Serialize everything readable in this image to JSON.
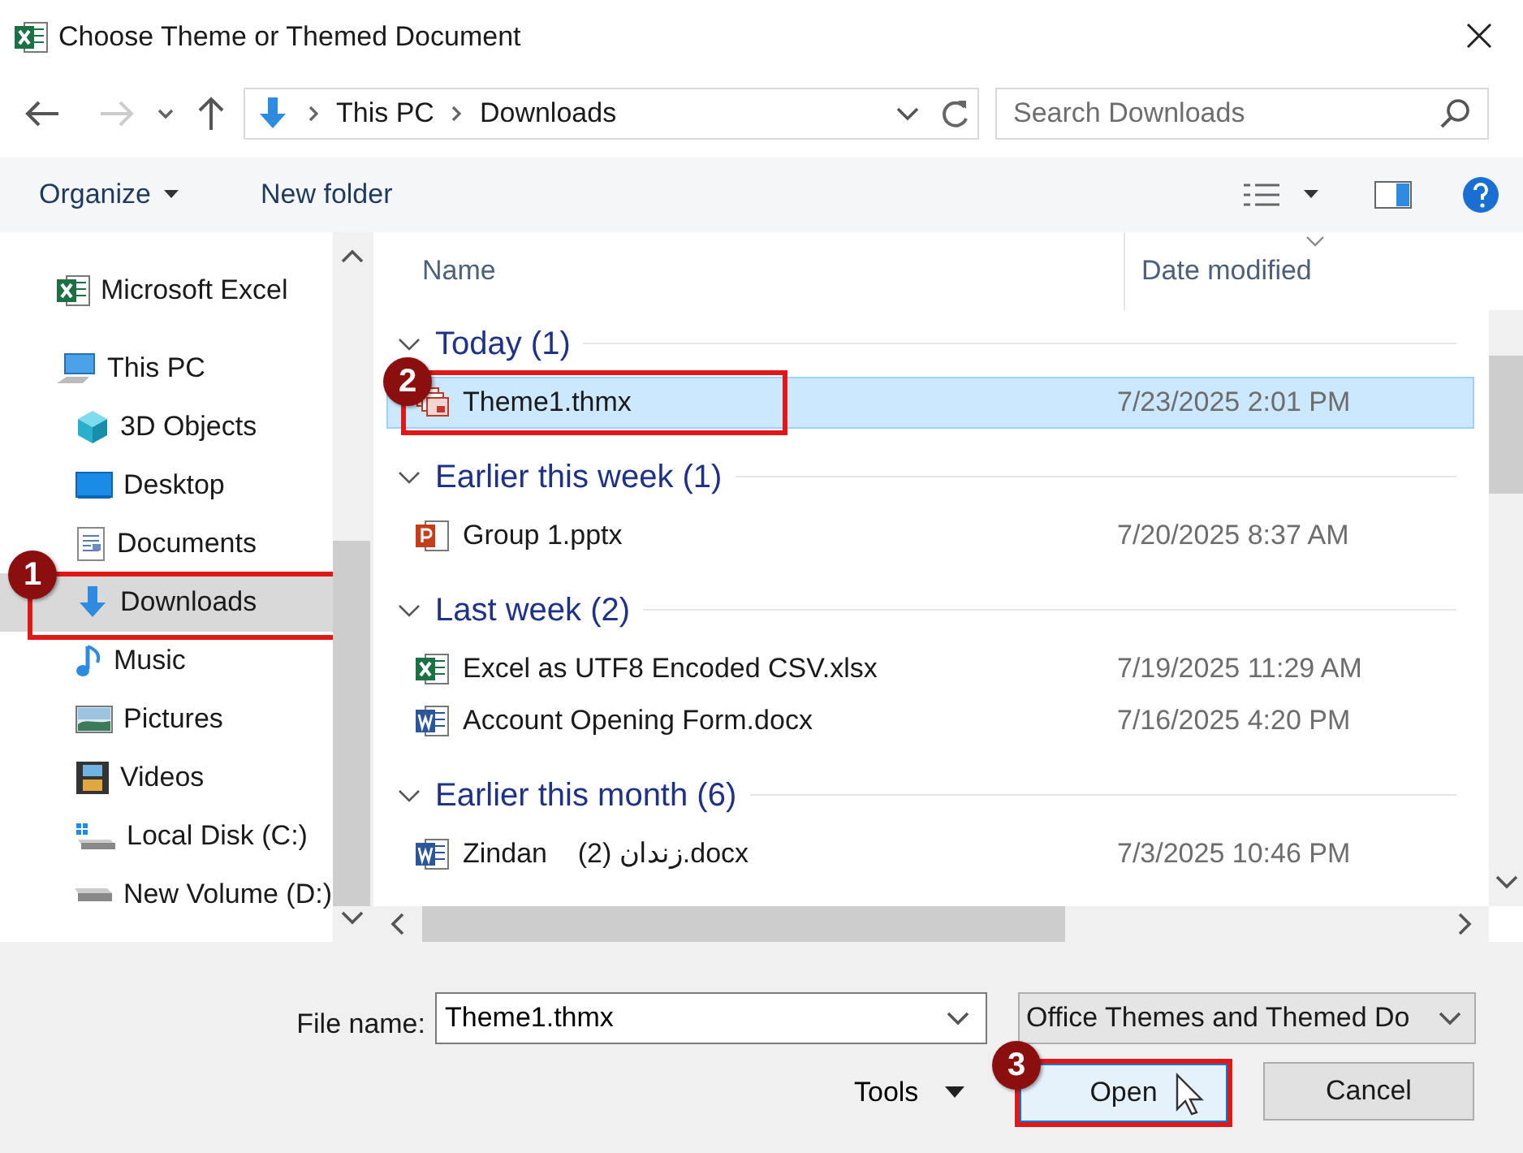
{
  "window": {
    "title": "Choose Theme or Themed Document"
  },
  "address": {
    "path": [
      "This PC",
      "Downloads"
    ]
  },
  "search": {
    "placeholder": "Search Downloads"
  },
  "toolbar": {
    "organize": "Organize",
    "new_folder": "New folder"
  },
  "sidebar": {
    "items": [
      {
        "label": "Microsoft Excel",
        "kind": "excel",
        "selected": false
      },
      {
        "label": "This PC",
        "kind": "pc",
        "selected": false,
        "children": [
          {
            "label": "3D Objects",
            "kind": "cube",
            "selected": false
          },
          {
            "label": "Desktop",
            "kind": "desktop",
            "selected": false
          },
          {
            "label": "Documents",
            "kind": "documents",
            "selected": false
          },
          {
            "label": "Downloads",
            "kind": "downloads",
            "selected": true,
            "callout": "1"
          },
          {
            "label": "Music",
            "kind": "music",
            "selected": false
          },
          {
            "label": "Pictures",
            "kind": "pictures",
            "selected": false
          },
          {
            "label": "Videos",
            "kind": "videos",
            "selected": false
          },
          {
            "label": "Local Disk (C:)",
            "kind": "disk_c",
            "selected": false
          },
          {
            "label": "New Volume (D:)",
            "kind": "disk",
            "selected": false
          }
        ]
      }
    ]
  },
  "file_list": {
    "columns": [
      "Name",
      "Date modified"
    ],
    "groups": [
      {
        "label": "Today (1)",
        "expanded": true,
        "files": [
          {
            "name": "Theme1.thmx",
            "kind": "theme",
            "date": "7/23/2025 2:01 PM",
            "selected": true,
            "callout": "2"
          }
        ]
      },
      {
        "label": "Earlier this week (1)",
        "expanded": true,
        "files": [
          {
            "name": "Group 1.pptx",
            "kind": "pptx",
            "date": "7/20/2025 8:37 AM",
            "selected": false
          }
        ]
      },
      {
        "label": "Last week (2)",
        "expanded": true,
        "files": [
          {
            "name": "Excel as UTF8 Encoded CSV.xlsx",
            "kind": "xlsx",
            "date": "7/19/2025 11:29 AM",
            "selected": false
          },
          {
            "name": "Account Opening Form.docx",
            "kind": "docx",
            "date": "7/16/2025 4:20 PM",
            "selected": false
          }
        ]
      },
      {
        "label": "Earlier this month (6)",
        "expanded": true,
        "files": [
          {
            "name": "Zindan    زندان (2).docx",
            "kind": "docx",
            "date": "7/3/2025 10:46 PM",
            "selected": false
          }
        ]
      }
    ]
  },
  "footer": {
    "file_name_label": "File name:",
    "file_name": "Theme1.thmx",
    "file_type": "Office Themes and Themed Do",
    "tools": "Tools",
    "open": "Open",
    "open_callout": "3",
    "cancel": "Cancel"
  }
}
